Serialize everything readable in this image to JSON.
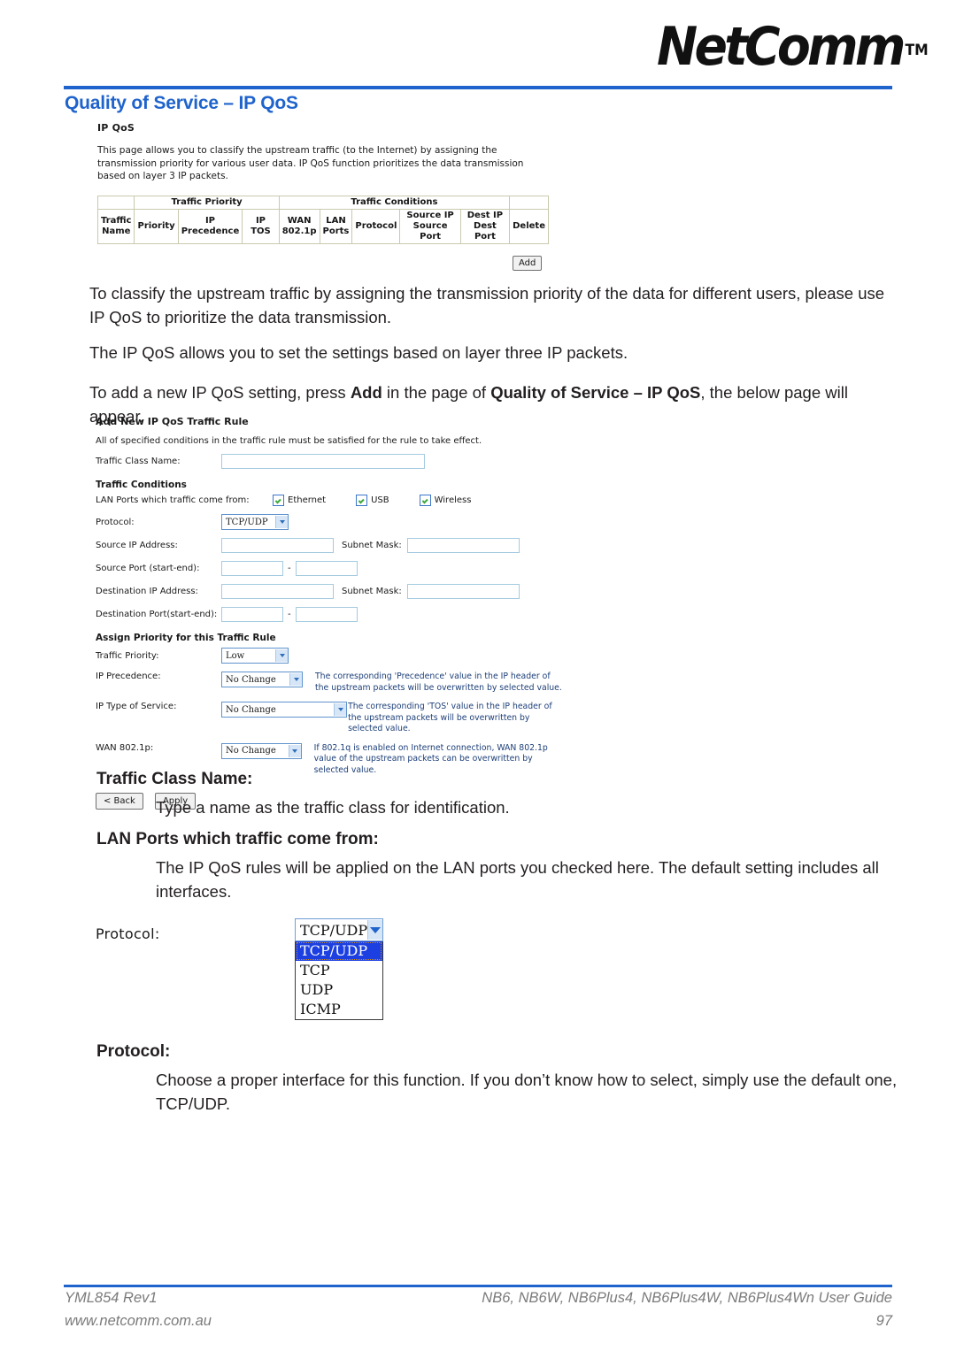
{
  "header": {
    "logo_text": "NetComm",
    "logo_tm": "TM",
    "page_title": "Quality of Service – IP QoS"
  },
  "screenshot_ip_qos": {
    "heading": "IP QoS",
    "description": "This page allows you to classify the upstream traffic (to the Internet) by assigning the transmission priority for various user data. IP QoS function prioritizes the data transmission based on layer 3 IP packets.",
    "table": {
      "group_headers": [
        "",
        "Traffic Priority",
        "Traffic Conditions",
        ""
      ],
      "columns": [
        "Traffic Name",
        "Priority",
        "IP Precedence",
        "IP TOS",
        "WAN 802.1p",
        "LAN Ports",
        "Protocol",
        "Source IP Source Port",
        "Dest IP Dest Port",
        "Delete"
      ],
      "col_lines": {
        "traffic_name": [
          "Traffic",
          "Name"
        ],
        "priority": [
          "Priority"
        ],
        "ip_precedence": [
          "IP",
          "Precedence"
        ],
        "ip_tos": [
          "IP TOS"
        ],
        "wan_8021p": [
          "WAN",
          "802.1p"
        ],
        "lan_ports": [
          "LAN",
          "Ports"
        ],
        "protocol": [
          "Protocol"
        ],
        "source": [
          "Source IP",
          "Source Port"
        ],
        "dest": [
          "Dest IP",
          "Dest Port"
        ],
        "delete": [
          "Delete"
        ]
      },
      "rows": []
    },
    "add_button": "Add"
  },
  "body": {
    "para1": "To classify the upstream traffic by assigning the transmission priority of the data for different users, please use IP QoS to prioritize the data transmission.",
    "para2": "The IP QoS allows you to set the settings based on layer three IP packets.",
    "para3_a": "To add a new IP QoS setting, press ",
    "para3_b": "Add",
    "para3_c": " in the page of ",
    "para3_d": "Quality of Service – IP QoS",
    "para3_e": ", the below page will appear."
  },
  "screenshot_add_rule": {
    "heading": "Add New IP QoS Traffic Rule",
    "subtitle": "All of specified conditions in the traffic rule must be satisfied for the rule to take effect.",
    "traffic_class_name_label": "Traffic Class Name:",
    "traffic_class_name_value": "",
    "traffic_conditions_header": "Traffic Conditions",
    "lan_ports_label": "LAN Ports which traffic come from:",
    "lan_ports": [
      {
        "label": "Ethernet",
        "checked": true
      },
      {
        "label": "USB",
        "checked": true
      },
      {
        "label": "Wireless",
        "checked": true
      }
    ],
    "protocol_label": "Protocol:",
    "protocol_value": "TCP/UDP",
    "source_ip_label": "Source IP Address:",
    "source_ip_value": "",
    "source_subnet_label": "Subnet Mask:",
    "source_subnet_value": "",
    "source_port_label": "Source Port (start-end):",
    "source_port_start": "",
    "source_port_end": "",
    "dest_ip_label": "Destination IP Address:",
    "dest_ip_value": "",
    "dest_subnet_label": "Subnet Mask:",
    "dest_subnet_value": "",
    "dest_port_label": "Destination Port(start-end):",
    "dest_port_start": "",
    "dest_port_end": "",
    "assign_priority_header": "Assign Priority for this Traffic Rule",
    "traffic_priority_label": "Traffic Priority:",
    "traffic_priority_value": "Low",
    "ip_precedence_label": "IP Precedence:",
    "ip_precedence_value": "No Change",
    "ip_precedence_hint": "The corresponding 'Precedence' value in the IP header of the upstream packets will be overwritten by selected value.",
    "ip_tos_label": "IP Type of Service:",
    "ip_tos_value": "No Change",
    "ip_tos_hint": "The corresponding 'TOS' value in the IP header of the upstream packets will be overwritten by selected value.",
    "wan_8021p_label": "WAN 802.1p:",
    "wan_8021p_value": "No Change",
    "wan_8021p_hint": "If 802.1q is enabled on Internet connection, WAN 802.1p value of the upstream packets can be overwritten by selected value.",
    "back_button": "< Back",
    "apply_button": "Apply",
    "dash": "-"
  },
  "sections": {
    "traffic_class_name_heading": "Traffic Class Name:",
    "traffic_class_name_body": "Type a name as the traffic class for identification.",
    "lan_ports_heading": "LAN Ports which traffic come from:",
    "lan_ports_body": "The IP QoS rules will be applied on the LAN ports you checked here. The default setting includes all interfaces.",
    "protocol_heading": "Protocol:",
    "protocol_body": "Choose a proper interface for this function. If you don’t know how to select, simply use the default one, TCP/UDP."
  },
  "protocol_dropdown": {
    "label": "Protocol:",
    "selected": "TCP/UDP",
    "options": [
      "TCP/UDP",
      "TCP",
      "UDP",
      "ICMP"
    ]
  },
  "footer": {
    "left_line1": "YML854 Rev1",
    "left_line2": "www.netcomm.com.au",
    "right_line1": "NB6, NB6W, NB6Plus4, NB6Plus4W, NB6Plus4Wn User Guide",
    "right_line2": "97"
  },
  "colors": {
    "accent_blue": "#1f63cc",
    "hint_blue": "#1d3f78",
    "footer_gray": "#7b7b7b",
    "table_border": "#c9c9ae",
    "select_highlight": "#1b3fe0"
  }
}
